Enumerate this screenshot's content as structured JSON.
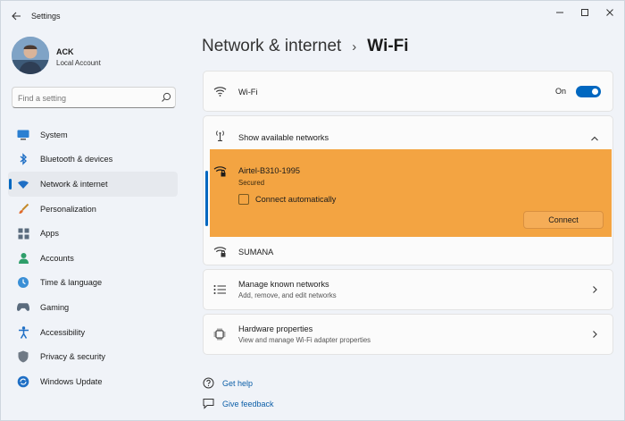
{
  "window": {
    "title": "Settings"
  },
  "profile": {
    "name": "ACK",
    "account": "Local Account"
  },
  "search": {
    "placeholder": "Find a setting"
  },
  "nav": {
    "items": [
      {
        "label": "System",
        "icon": "monitor-icon"
      },
      {
        "label": "Bluetooth & devices",
        "icon": "bluetooth-icon"
      },
      {
        "label": "Network & internet",
        "icon": "wifi-icon",
        "active": true
      },
      {
        "label": "Personalization",
        "icon": "brush-icon"
      },
      {
        "label": "Apps",
        "icon": "apps-icon"
      },
      {
        "label": "Accounts",
        "icon": "person-icon"
      },
      {
        "label": "Time & language",
        "icon": "globe-clock-icon"
      },
      {
        "label": "Gaming",
        "icon": "gamepad-icon"
      },
      {
        "label": "Accessibility",
        "icon": "accessibility-icon"
      },
      {
        "label": "Privacy & security",
        "icon": "shield-icon"
      },
      {
        "label": "Windows Update",
        "icon": "update-icon"
      }
    ]
  },
  "header": {
    "parent": "Network & internet",
    "current": "Wi-Fi"
  },
  "wifi": {
    "label": "Wi-Fi",
    "state": "On"
  },
  "networks": {
    "label": "Show available networks",
    "selected": {
      "name": "Airtel-B310-1995",
      "status": "Secured",
      "auto_label": "Connect automatically",
      "connect_label": "Connect"
    },
    "other": {
      "name": "SUMANA"
    }
  },
  "known": {
    "label": "Manage known networks",
    "sub": "Add, remove, and edit networks"
  },
  "hardware": {
    "label": "Hardware properties",
    "sub": "View and manage Wi-Fi adapter properties"
  },
  "footer": {
    "help": "Get help",
    "feedback": "Give feedback"
  },
  "colors": {
    "accent": "#0067c0",
    "highlight": "#f3a442"
  }
}
